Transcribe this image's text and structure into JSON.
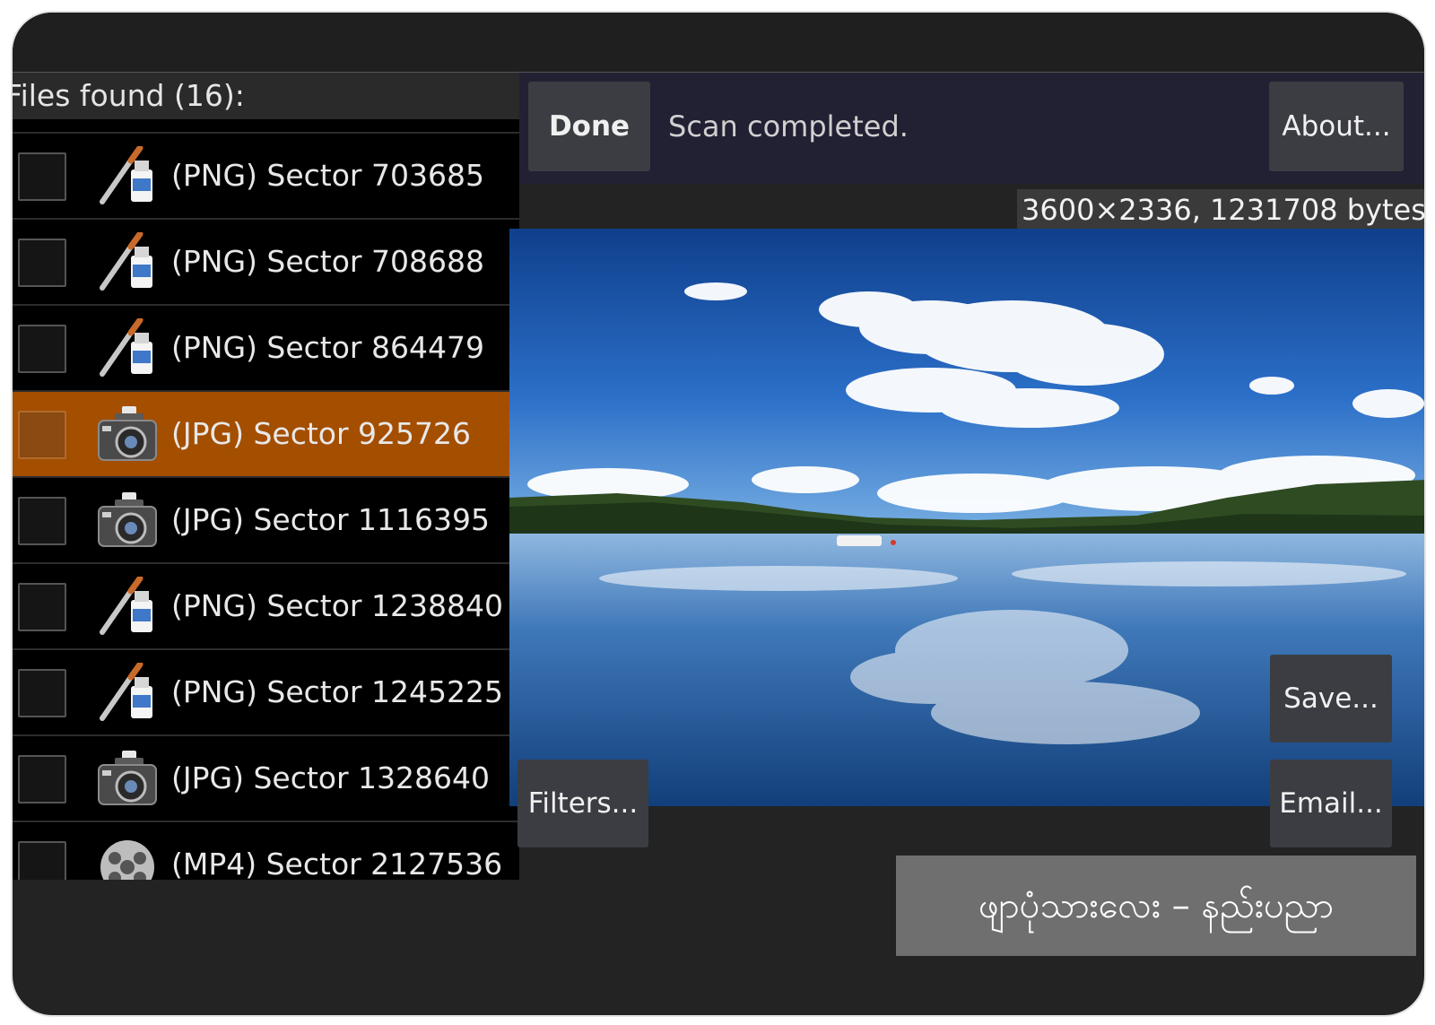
{
  "list": {
    "header": "Files found (16):",
    "items": [
      {
        "label": "(PNG) Sector 703685",
        "icon": "paint-brush-icon",
        "selected": false
      },
      {
        "label": "(PNG) Sector 708688",
        "icon": "paint-brush-icon",
        "selected": false
      },
      {
        "label": "(PNG) Sector 864479",
        "icon": "paint-brush-icon",
        "selected": false
      },
      {
        "label": "(JPG) Sector 925726",
        "icon": "camera-icon",
        "selected": true
      },
      {
        "label": "(JPG) Sector 1116395",
        "icon": "camera-icon",
        "selected": false
      },
      {
        "label": "(PNG) Sector 1238840",
        "icon": "paint-brush-icon",
        "selected": false
      },
      {
        "label": "(PNG) Sector 1245225",
        "icon": "paint-brush-icon",
        "selected": false
      },
      {
        "label": "(JPG) Sector 1328640",
        "icon": "camera-icon",
        "selected": false
      },
      {
        "label": "(MP4) Sector 2127536",
        "icon": "film-reel-icon",
        "selected": false
      }
    ]
  },
  "toolbar": {
    "done_label": "Done",
    "status_text": "Scan completed.",
    "about_label": "About..."
  },
  "preview": {
    "info": "3600×2336, 1231708 bytes.",
    "image_icon": "lake-landscape-image"
  },
  "actions": {
    "filters_label": "Filters...",
    "save_label": "Save...",
    "email_label": "Email..."
  },
  "caption": {
    "text": "ဖျာပုံသားလေး – နည်းပညာ"
  },
  "colors": {
    "selected_row": "#a44e00",
    "topbar": "#222033",
    "button": "#3b3d43"
  }
}
